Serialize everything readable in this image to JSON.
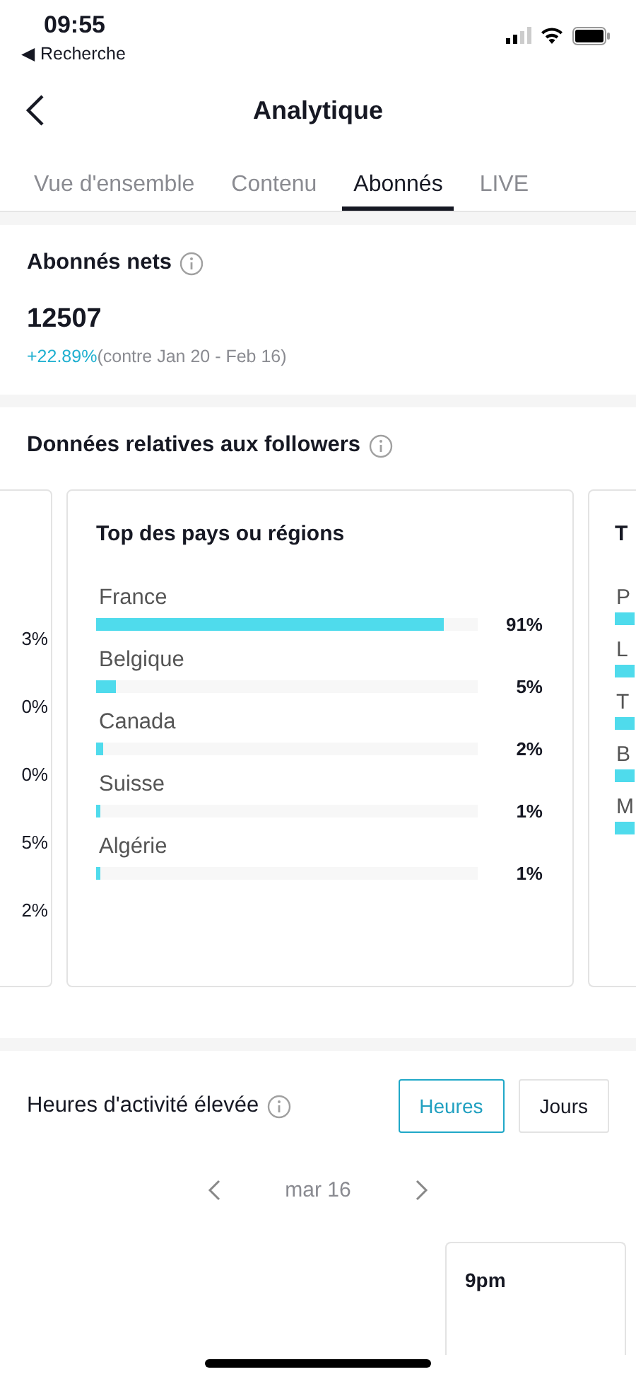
{
  "status_bar": {
    "time": "09:55",
    "back_app": "◀ Recherche"
  },
  "nav": {
    "title": "Analytique"
  },
  "tabs": [
    {
      "label": "Vue d'ensemble",
      "selected": false
    },
    {
      "label": "Contenu",
      "selected": false
    },
    {
      "label": "Abonnés",
      "selected": true
    },
    {
      "label": "LIVE",
      "selected": false
    }
  ],
  "net_followers": {
    "title": "Abonnés nets",
    "value": "12507",
    "change": "+22.89%",
    "comparison": "(contre Jan 20 - Feb 16)"
  },
  "followers_data": {
    "title": "Données relatives aux followers",
    "left_card": {
      "values": [
        "3%",
        "0%",
        "0%",
        "5%",
        "2%"
      ]
    },
    "center_card": {
      "title": "Top des pays ou régions",
      "rows": [
        {
          "name": "France",
          "level": 0.91,
          "value": "91%"
        },
        {
          "name": "Belgique",
          "level": 0.05,
          "value": "5%"
        },
        {
          "name": "Canada",
          "level": 0.02,
          "value": "2%"
        },
        {
          "name": "Suisse",
          "level": 0.01,
          "value": "1%"
        },
        {
          "name": "Algérie",
          "level": 0.01,
          "value": "1%"
        }
      ]
    },
    "right_card": {
      "title": "T",
      "labels": [
        "P",
        "L",
        "T",
        "B",
        "M"
      ]
    }
  },
  "activity": {
    "title": "Heures d'activité élevée",
    "toggles": [
      {
        "label": "Heures",
        "selected": true
      },
      {
        "label": "Jours",
        "selected": false
      }
    ],
    "date": "mar 16",
    "hour": "9pm"
  }
}
